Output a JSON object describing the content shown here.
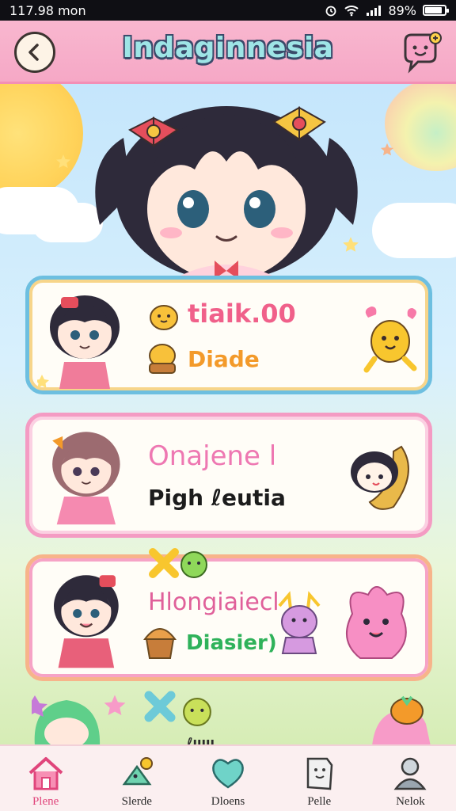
{
  "status_bar": {
    "time": "117.98 mon",
    "battery": "89%",
    "battery_level": 0.89
  },
  "header": {
    "title": "Indaginnesia"
  },
  "cards": [
    {
      "line1": "tiaik.00",
      "line2": "Diade",
      "line1_color": "#f0608a",
      "line2_color": "#f39a2a"
    },
    {
      "line1": "Onajene l",
      "line2": "Pigh ℓeutia",
      "line1_color": "#ee78b2",
      "line2_color": "#1c1c1c"
    },
    {
      "line1": "Hlongiaiecl",
      "line2": "Diasier)",
      "line1_color": "#e0609a",
      "line2_color": "#2fb25a"
    }
  ],
  "peek_text": "ℓııııı",
  "nav": [
    {
      "label": "Plene",
      "icon": "home-icon",
      "active": true
    },
    {
      "label": "Slerde",
      "icon": "star-bird-icon",
      "active": false
    },
    {
      "label": "Dloens",
      "icon": "heart-icon",
      "active": false
    },
    {
      "label": "Pelle",
      "icon": "note-icon",
      "active": false
    },
    {
      "label": "Nelok",
      "icon": "profile-icon",
      "active": false
    }
  ],
  "colors": {
    "header_pink": "#f6a8c6",
    "accent_blue": "#6dbfe0",
    "accent_pink": "#f49bc3",
    "accent_orange": "#f7b48a"
  }
}
